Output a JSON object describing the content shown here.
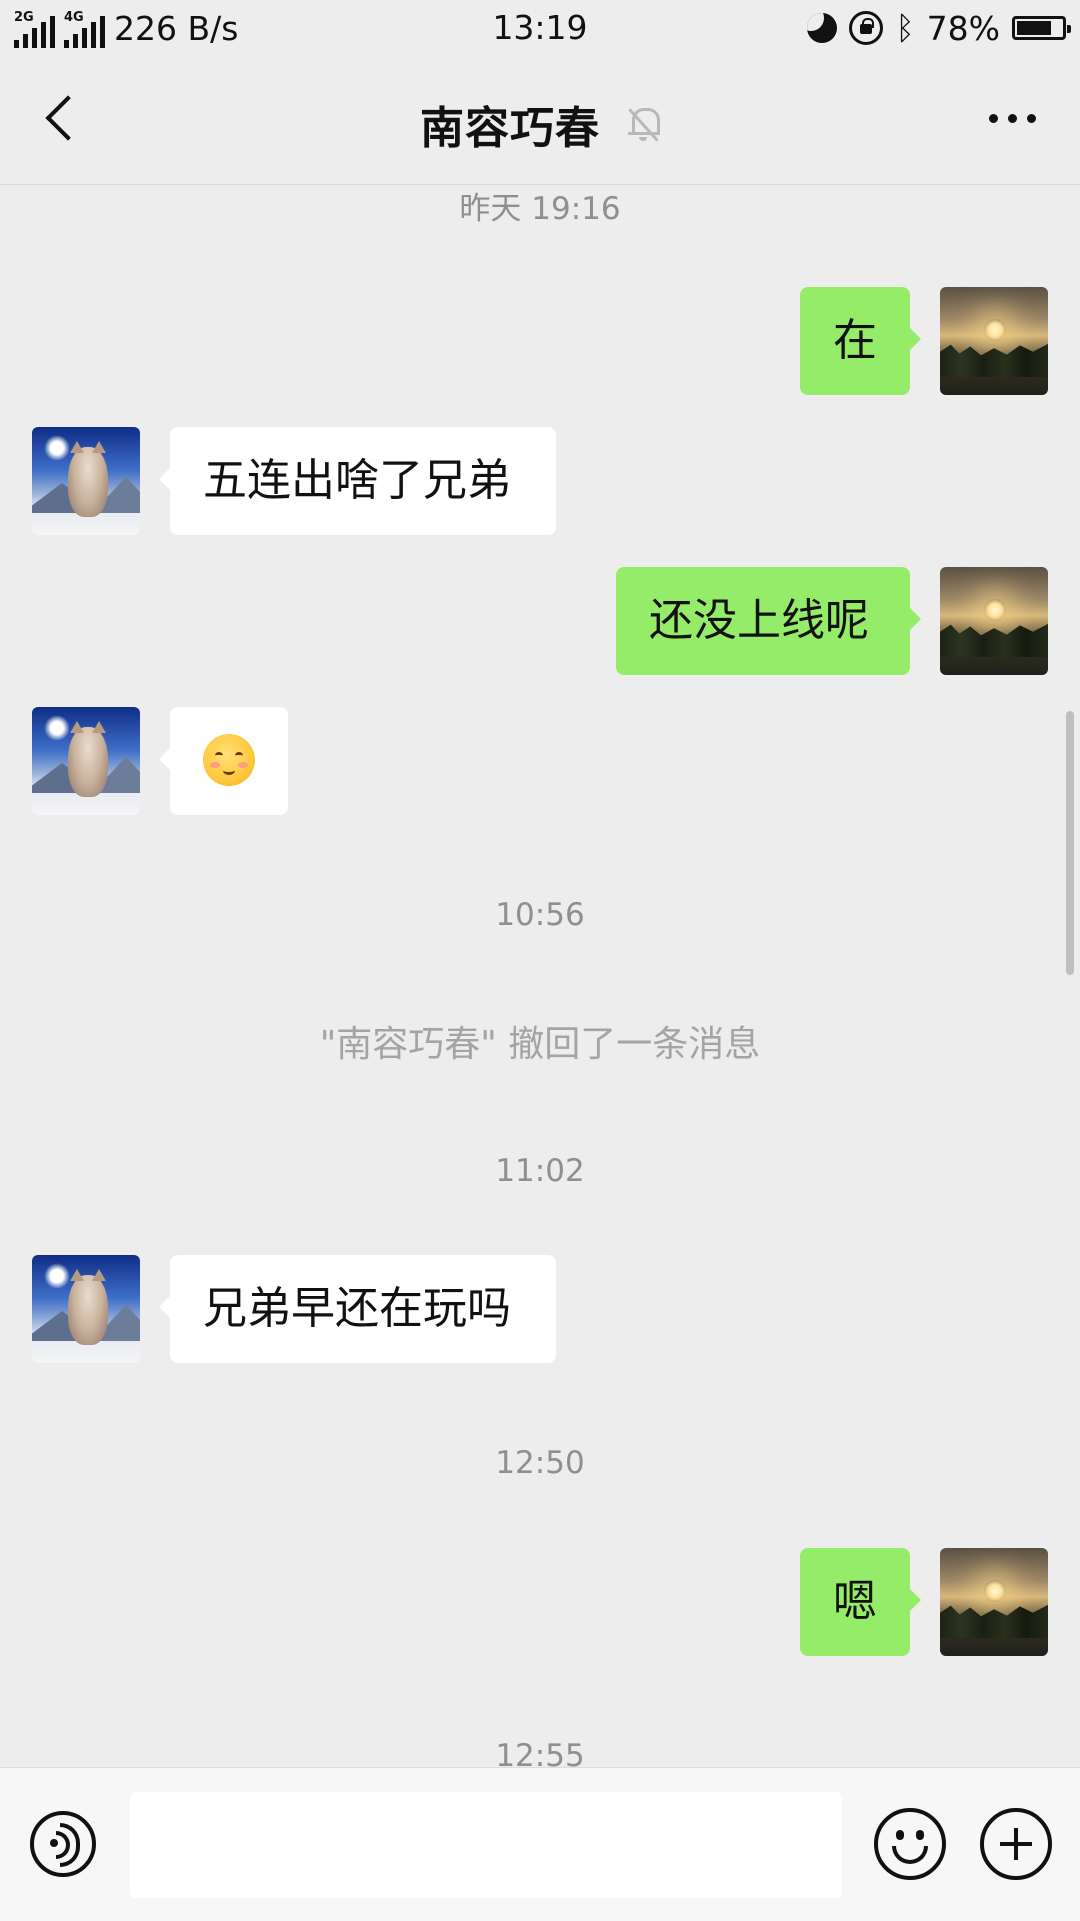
{
  "status_bar": {
    "network_1": "2G",
    "network_2": "4G",
    "speed": "226 B/s",
    "time": "13:19",
    "battery": "78%",
    "battery_level": 0.78,
    "icons": [
      "moon-icon",
      "rotation-lock-icon",
      "bluetooth-icon",
      "battery-icon"
    ]
  },
  "header": {
    "title": "南容巧春",
    "back_icon": "chevron-left-icon",
    "mute_icon": "bell-off-icon",
    "more_icon": "more-dots-icon"
  },
  "messages": {
    "ts_1": "昨天 19:16",
    "m1": "在",
    "m2": "五连出啥了兄弟",
    "m3": "还没上线呢",
    "m4_emoji": "blush-emoji",
    "ts_2": "10:56",
    "system_recall": "\"南容巧春\" 撤回了一条消息",
    "ts_3": "11:02",
    "m5": "兄弟早还在玩吗",
    "ts_4": "12:50",
    "m6": "嗯",
    "ts_5": "12:55"
  },
  "input_bar": {
    "input_value": "",
    "voice_icon": "voice-icon",
    "emoji_icon": "emoji-icon",
    "plus_icon": "plus-icon"
  },
  "colors": {
    "background": "#ededed",
    "outgoing_bubble": "#95ec69",
    "incoming_bubble": "#ffffff"
  }
}
